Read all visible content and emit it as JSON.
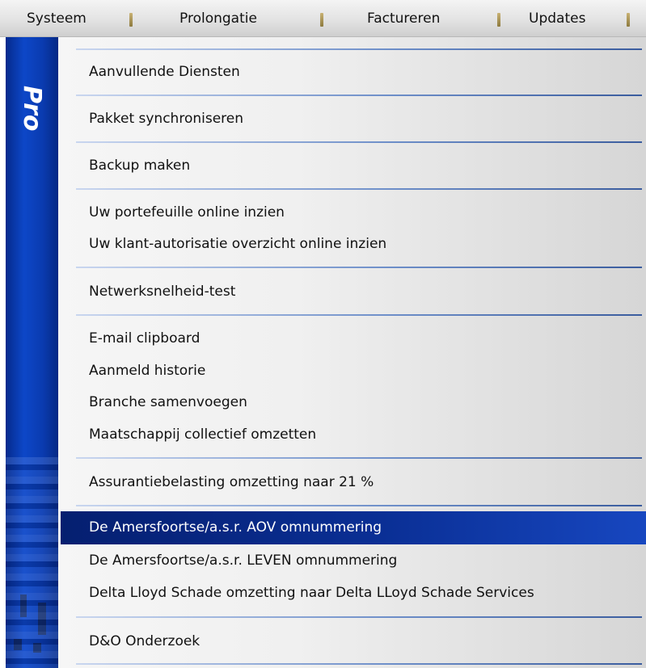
{
  "menubar": {
    "items": [
      {
        "label": "Systeem"
      },
      {
        "label": "Prolongatie"
      },
      {
        "label": "Factureren"
      },
      {
        "label": "Updates"
      }
    ]
  },
  "sidebar": {
    "logo_text": "Pro"
  },
  "dropdown": {
    "items": [
      "Aanvullende Diensten",
      "Pakket synchroniseren",
      "Backup maken",
      "Uw portefeuille online inzien",
      "Uw klant-autorisatie overzicht online inzien",
      "Netwerksnelheid-test",
      "E-mail clipboard",
      "Aanmeld historie",
      "Branche samenvoegen",
      "Maatschappij collectief omzetten",
      "Assurantiebelasting omzetting naar 21 %",
      "De Amersfoortse/a.s.r. AOV omnummering",
      "De Amersfoortse/a.s.r. LEVEN omnummering",
      "Delta Lloyd Schade omzetting naar Delta LLoyd Schade Services",
      "D&O Onderzoek"
    ],
    "highlighted_item": "De Amersfoortse/a.s.r. AOV omnummering"
  },
  "colors": {
    "highlight": "#0a2f95",
    "sidebar": "#0d47c8",
    "separator": "#3a5c9e"
  }
}
